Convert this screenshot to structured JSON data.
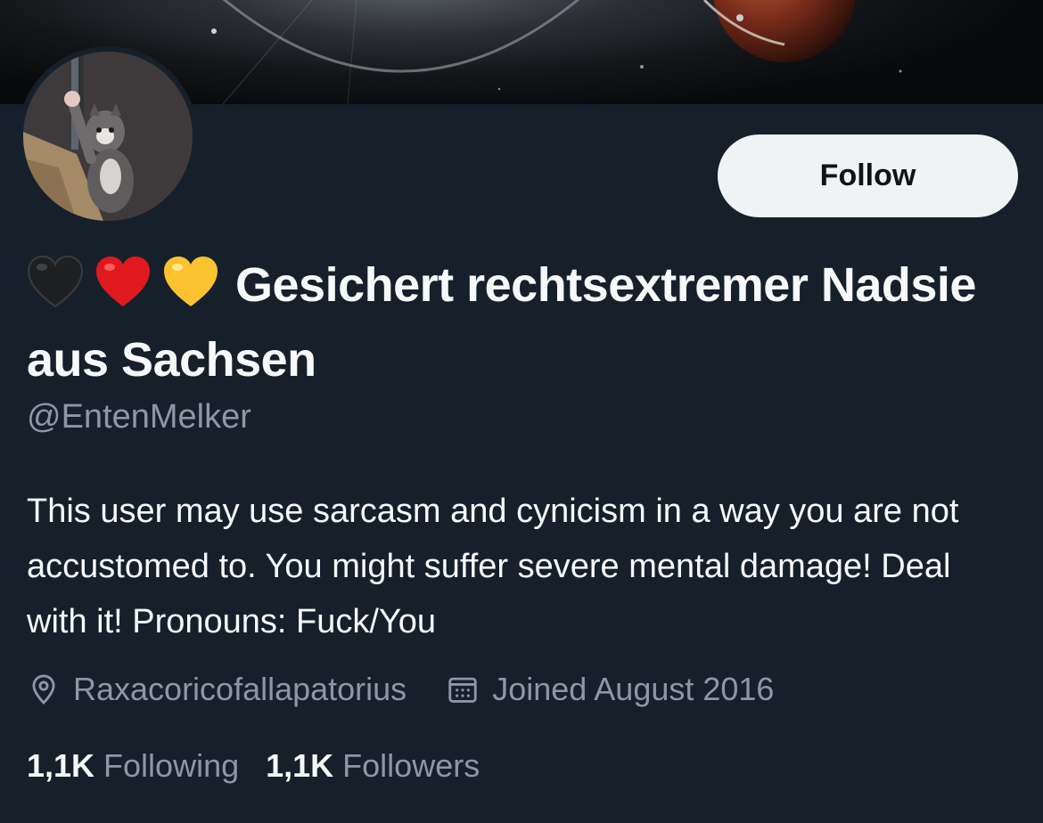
{
  "profile": {
    "display_name_emojis": [
      "black-heart",
      "red-heart",
      "yellow-heart"
    ],
    "display_name": "Gesichert rechtsextremer Nadsie aus Sachsen",
    "handle": "@EntenMelker",
    "bio": "This user may use sarcasm and cynicism in a way you are not accustomed to. You might suffer severe mental damage! Deal with it! Pronouns: Fuck/You",
    "location": "Raxacoricofallapatorius",
    "joined": "Joined August 2016",
    "following_count": "1,1K",
    "following_label": "Following",
    "followers_count": "1,1K",
    "followers_label": "Followers"
  },
  "actions": {
    "follow_label": "Follow"
  },
  "icons": {
    "location": "location-pin-icon",
    "joined": "calendar-icon"
  },
  "colors": {
    "background": "#15202b",
    "primary_text": "#f7f9f9",
    "secondary_text": "#8b98a5",
    "follow_button_bg": "#eff3f4"
  }
}
